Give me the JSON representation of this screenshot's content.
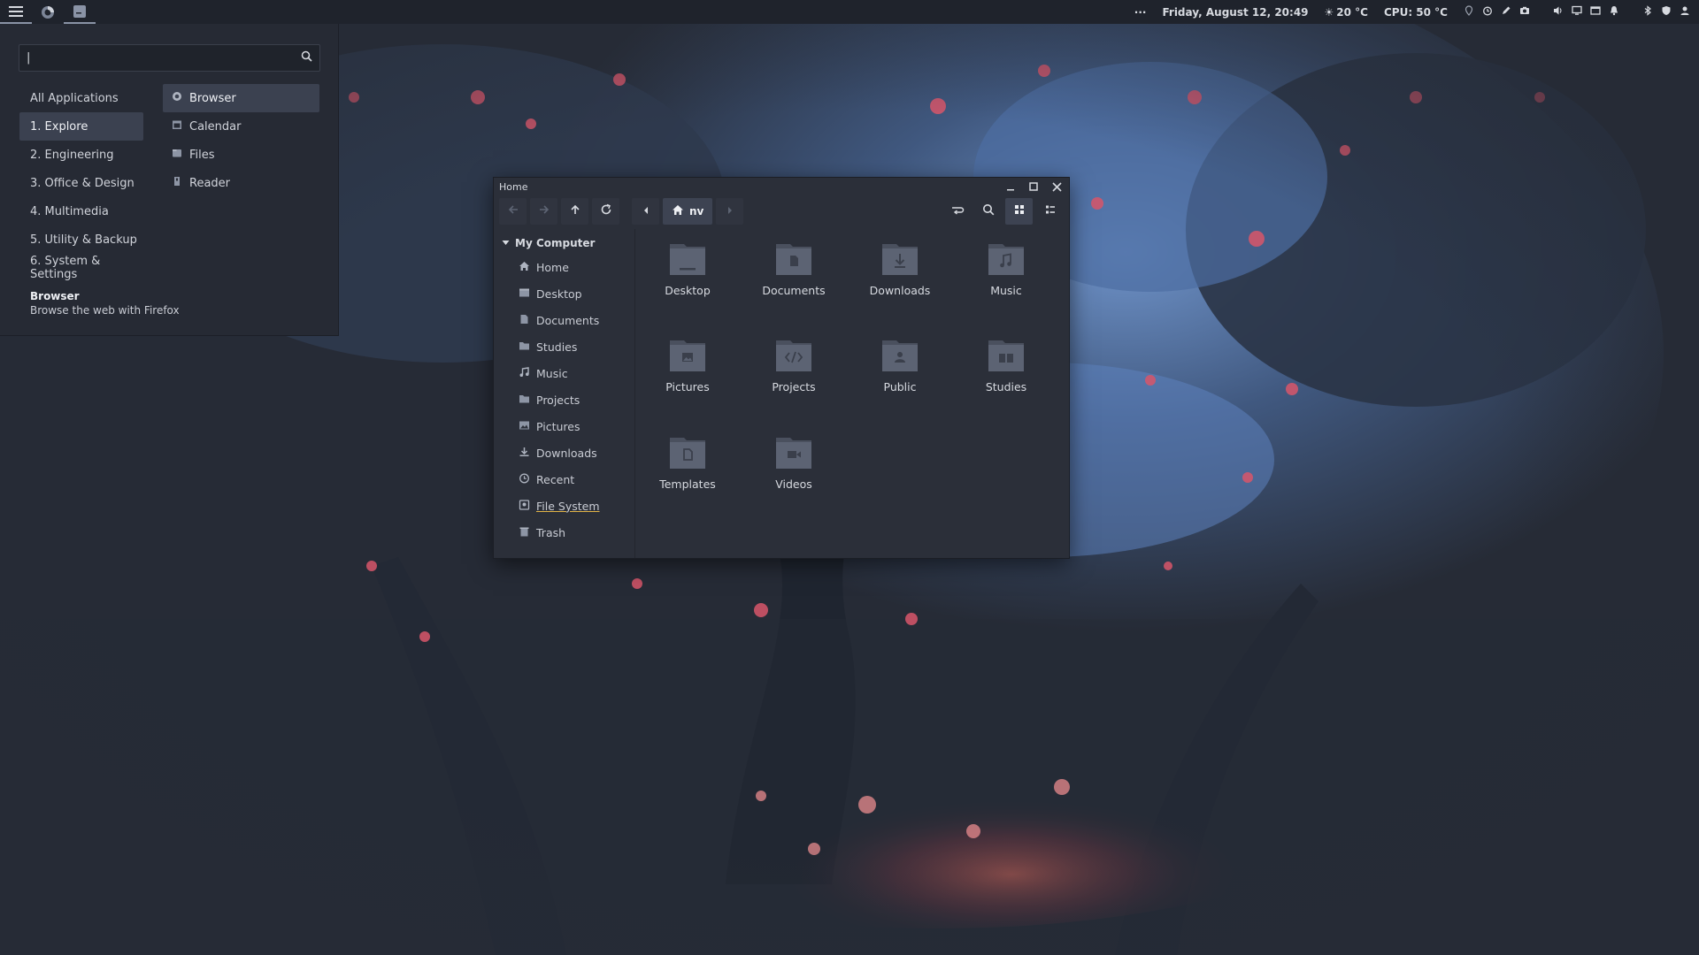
{
  "panel": {
    "datetime": "Friday, August 12, 20:49",
    "weather": "20 °C",
    "cpu": "CPU: 50 °C",
    "overflow": "···",
    "icons": [
      "menu-icon",
      "firefox-icon",
      "terminal-icon"
    ],
    "tray_icons": [
      "location-icon",
      "alarm-icon",
      "pen-icon",
      "camera-icon",
      "volume-icon",
      "display-icon",
      "window-icon",
      "bell-icon",
      "bluetooth-icon",
      "shield-icon",
      "user-icon"
    ]
  },
  "app_menu": {
    "search_value": "|",
    "categories": [
      {
        "label": "All Applications"
      },
      {
        "label": "1. Explore"
      },
      {
        "label": "2. Engineering"
      },
      {
        "label": "3. Office & Design"
      },
      {
        "label": "4. Multimedia"
      },
      {
        "label": "5. Utility & Backup"
      },
      {
        "label": "6. System & Settings"
      }
    ],
    "active_category": "1. Explore",
    "apps": [
      {
        "label": "Browser",
        "icon": "firefox-icon"
      },
      {
        "label": "Calendar",
        "icon": "calendar-icon"
      },
      {
        "label": "Files",
        "icon": "files-icon"
      },
      {
        "label": "Reader",
        "icon": "reader-icon"
      }
    ],
    "active_app": "Browser",
    "description_title": "Browser",
    "description_text": "Browse the web with Firefox"
  },
  "file_manager": {
    "title": "Home",
    "breadcrumb": "nv",
    "sidebar_header": "My Computer",
    "sidebar_items": [
      {
        "label": "Home",
        "icon": "home-icon"
      },
      {
        "label": "Desktop",
        "icon": "desktop-icon"
      },
      {
        "label": "Documents",
        "icon": "document-icon"
      },
      {
        "label": "Studies",
        "icon": "folder-icon"
      },
      {
        "label": "Music",
        "icon": "music-icon"
      },
      {
        "label": "Projects",
        "icon": "folder-icon"
      },
      {
        "label": "Pictures",
        "icon": "picture-icon"
      },
      {
        "label": "Downloads",
        "icon": "download-icon"
      },
      {
        "label": "Recent",
        "icon": "clock-icon"
      },
      {
        "label": "File System",
        "icon": "drive-icon"
      },
      {
        "label": "Trash",
        "icon": "trash-icon"
      }
    ],
    "items": [
      {
        "name": "Desktop",
        "icon": "desktop-folder-icon"
      },
      {
        "name": "Documents",
        "icon": "documents-folder-icon"
      },
      {
        "name": "Downloads",
        "icon": "downloads-folder-icon"
      },
      {
        "name": "Music",
        "icon": "music-folder-icon"
      },
      {
        "name": "Pictures",
        "icon": "pictures-folder-icon"
      },
      {
        "name": "Projects",
        "icon": "projects-folder-icon"
      },
      {
        "name": "Public",
        "icon": "public-folder-icon"
      },
      {
        "name": "Studies",
        "icon": "studies-folder-icon"
      },
      {
        "name": "Templates",
        "icon": "templates-folder-icon"
      },
      {
        "name": "Videos",
        "icon": "videos-folder-icon"
      }
    ]
  },
  "colors": {
    "panel_bg": "#1f232c",
    "menu_bg": "#262a34",
    "window_bg": "#2b2f39",
    "selection": "#3b4150",
    "folder": "#5c6373",
    "accent_underline": "#e2b447",
    "wallpaper_blue": "#5b7fb8",
    "wallpaper_pink": "#d8566a"
  }
}
